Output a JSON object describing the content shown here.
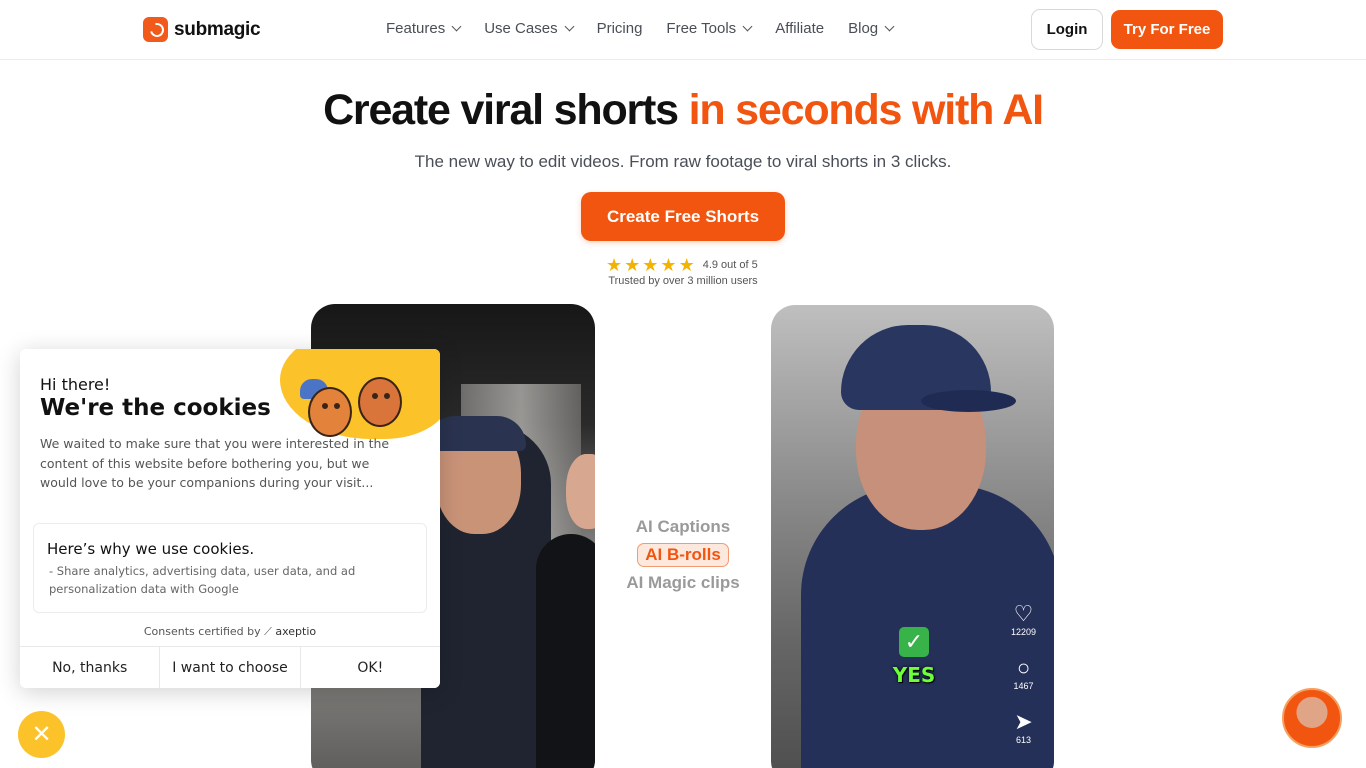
{
  "brand": {
    "name": "submagic",
    "accent": "#f2550f"
  },
  "nav": {
    "items": [
      {
        "label": "Features",
        "dropdown": true
      },
      {
        "label": "Use Cases",
        "dropdown": true
      },
      {
        "label": "Pricing",
        "dropdown": false
      },
      {
        "label": "Free Tools",
        "dropdown": true
      },
      {
        "label": "Affiliate",
        "dropdown": false
      },
      {
        "label": "Blog",
        "dropdown": true
      }
    ],
    "login": "Login",
    "try": "Try For Free"
  },
  "hero": {
    "title_plain": "Create viral shorts ",
    "title_accent": "in seconds with AI",
    "subtitle": "The new way to edit videos. From raw footage to viral shorts in 3 clicks.",
    "cta": "Create Free Shorts",
    "rating_text": "4.9 out of 5",
    "stars": 5,
    "trusted": "Trusted by over 3 million users"
  },
  "features": [
    {
      "label": "AI Captions",
      "active": false
    },
    {
      "label": "AI B-rolls",
      "active": true
    },
    {
      "label": "AI Magic clips",
      "active": false
    }
  ],
  "video_right": {
    "caption": "YES",
    "likes": "12209",
    "comments": "1467",
    "shares": "613"
  },
  "cookie": {
    "hi": "Hi there!",
    "title": "We're the cookies",
    "description": "We waited to make sure that you were interested in the content of this website before bothering you, but we would love to be your companions during your visit...",
    "why_title": "Here’s why we use cookies.",
    "why_item": "- Share analytics, advertising data, user data, and ad personalization data with Google",
    "certified_prefix": "Consents certified by",
    "certified_brand": "axeptio",
    "buttons": {
      "no": "No, thanks",
      "choose": "I want to choose",
      "ok": "OK!"
    }
  }
}
